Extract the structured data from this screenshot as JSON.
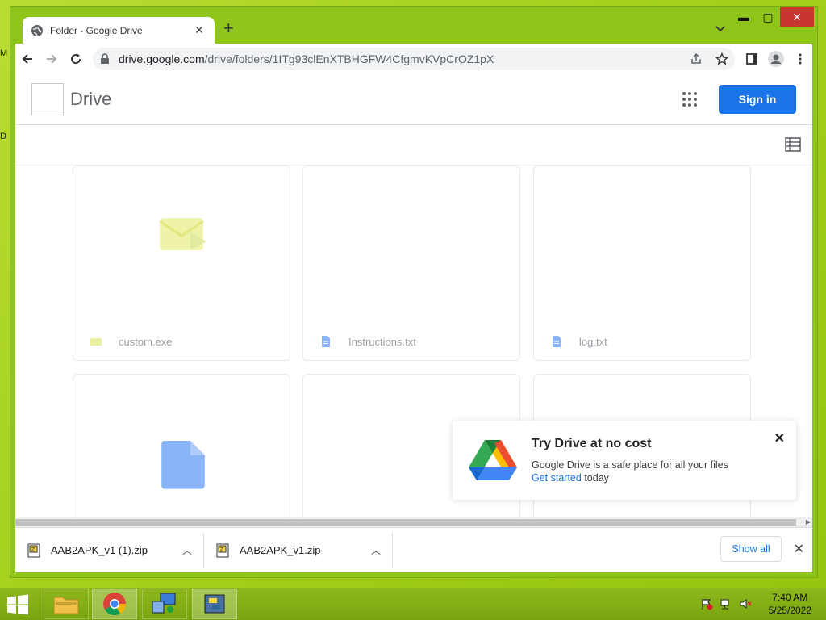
{
  "desktop": {
    "edge_letters": [
      "M",
      "D"
    ]
  },
  "tab": {
    "title": "Folder - Google Drive",
    "close": "✕"
  },
  "titlebar": {
    "new_tab": "+",
    "minimize": "▬",
    "maximize": "▢",
    "close": "✕"
  },
  "omnibox": {
    "host": "drive.google.com",
    "path": "/drive/folders/1ITg93clEnXTBHGFW4CfgmvKVpCrOZ1pX"
  },
  "drive": {
    "title": "Drive",
    "sign_in": "Sign in",
    "files": [
      {
        "name": "custom.exe",
        "icon": "exe-file-icon"
      },
      {
        "name": "Instructions.txt",
        "icon": "doc-file-icon"
      },
      {
        "name": "log.txt",
        "icon": "doc-file-icon"
      },
      {
        "name": "",
        "icon": "doc-file-icon"
      },
      {
        "name": "",
        "icon": ""
      },
      {
        "name": "",
        "icon": ""
      }
    ]
  },
  "promo": {
    "title": "Try Drive at no cost",
    "text": "Google Drive is a safe place for all your files",
    "link": "Get started",
    "after_link": " today",
    "close": "✕"
  },
  "downloads": {
    "items": [
      {
        "name": "AAB2APK_v1 (1).zip"
      },
      {
        "name": "AAB2APK_v1.zip"
      }
    ],
    "show_all": "Show all",
    "close": "✕",
    "chevron": "︿"
  },
  "taskbar": {
    "time": "7:40 AM",
    "date": "5/25/2022"
  },
  "colors": {
    "accent": "#1a73e8",
    "taskbar": "#8fb81e",
    "close": "#c7362f"
  }
}
